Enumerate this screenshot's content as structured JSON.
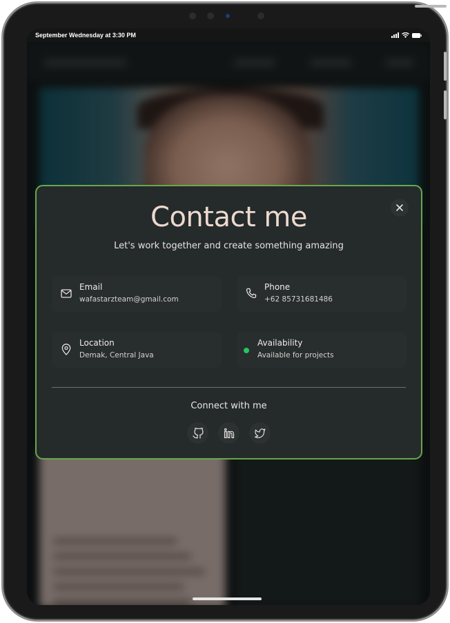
{
  "status_bar": {
    "time_text": "September Wednesday at 3:30 PM"
  },
  "modal": {
    "title": "Contact me",
    "subtitle": "Let's work together and create something amazing",
    "close_icon": "close-icon",
    "contacts": [
      {
        "label": "Email",
        "value": "wafastarzteam@gmail.com",
        "icon": "mail-icon"
      },
      {
        "label": "Phone",
        "value": "+62 85731681486",
        "icon": "phone-icon"
      },
      {
        "label": "Location",
        "value": "Demak, Central Java",
        "icon": "map-pin-icon"
      },
      {
        "label": "Availability",
        "value": "Available for projects",
        "icon": "status-dot"
      }
    ],
    "connect_label": "Connect with me",
    "socials": [
      "github-icon",
      "linkedin-icon",
      "twitter-icon"
    ]
  },
  "colors": {
    "modal_bg": "#252a2b",
    "modal_border": "#69a84a",
    "title": "#ecd9ce",
    "availability_dot": "#22c55e"
  }
}
